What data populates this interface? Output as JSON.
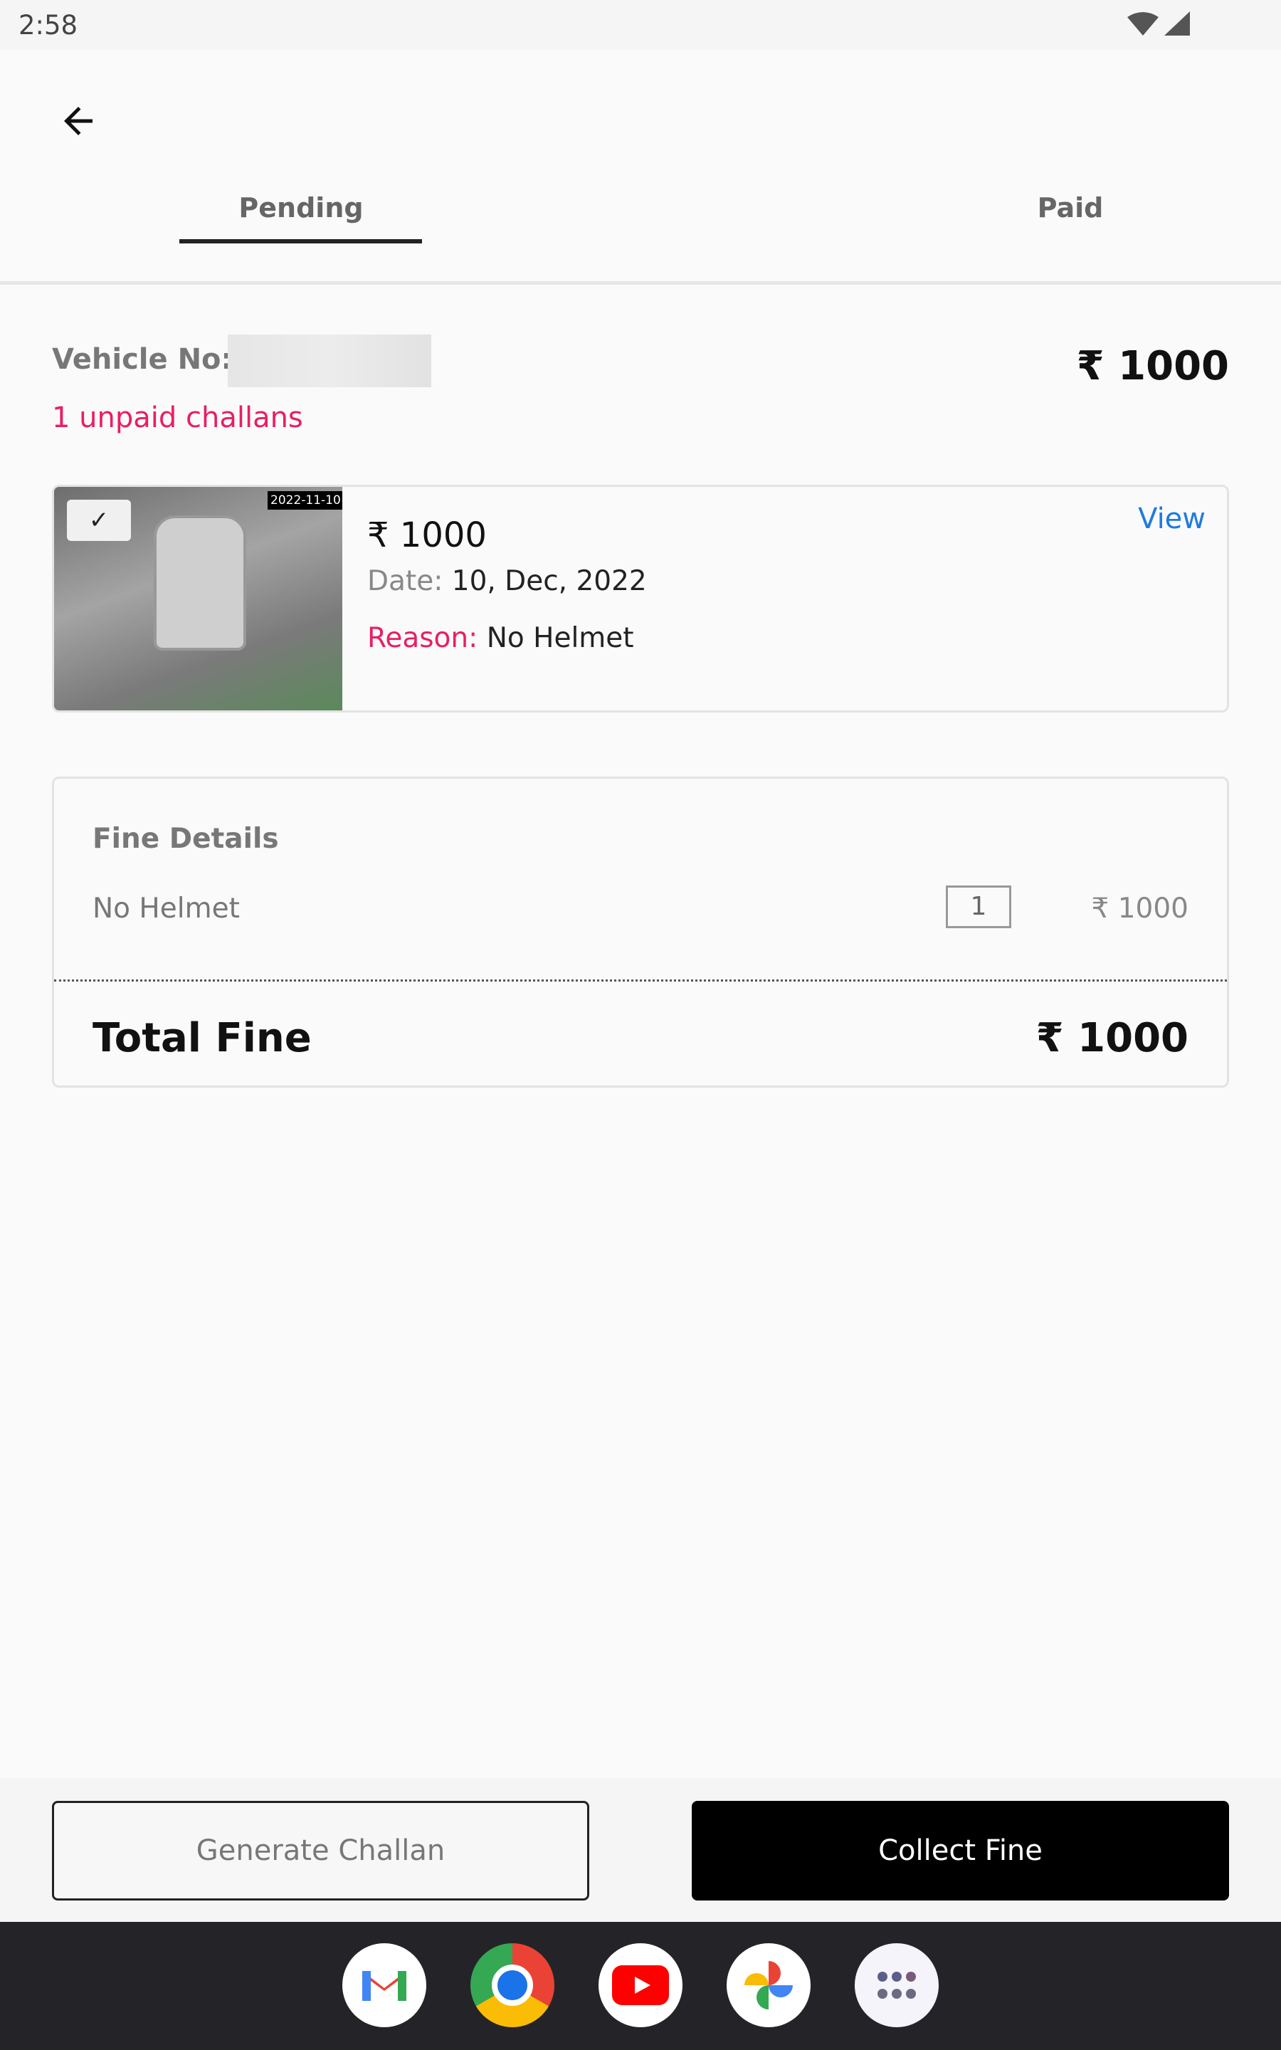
{
  "status_bar": {
    "time": "2:58",
    "icons": [
      "wifi-icon",
      "signal-icon"
    ]
  },
  "header": {
    "back_icon": "arrow-left-icon",
    "tabs": [
      {
        "label": "Pending",
        "active": true
      },
      {
        "label": "Paid",
        "active": false
      }
    ]
  },
  "summary": {
    "vehicle_label": "Vehicle No:",
    "total": "₹ 1000",
    "unpaid": "1 unpaid challans"
  },
  "challan": {
    "photo_timestamp": "2022-11-10",
    "checked": true,
    "amount": "₹ 1000",
    "date_label": "Date:",
    "date": "10, Dec, 2022",
    "reason_label": "Reason:",
    "reason": "No Helmet",
    "view_label": "View"
  },
  "fine_details": {
    "title": "Fine Details",
    "items": [
      {
        "name": "No Helmet",
        "qty": "1",
        "amount": "₹ 1000"
      }
    ],
    "total_label": "Total Fine",
    "total": "₹ 1000"
  },
  "actions": {
    "generate": "Generate Challan",
    "collect": "Collect Fine"
  },
  "dock": [
    "gmail-icon",
    "chrome-icon",
    "youtube-icon",
    "photos-icon",
    "app-drawer-icon"
  ],
  "colors": {
    "accent_pink": "#e91e63",
    "link_blue": "#1e7be0",
    "primary": "#000000"
  }
}
